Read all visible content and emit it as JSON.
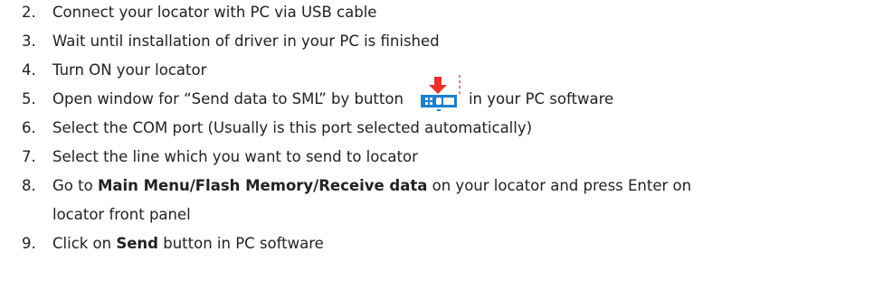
{
  "steps": [
    {
      "num": "2.",
      "text": "Connect your locator with PC via USB cable"
    },
    {
      "num": "3.",
      "text": "Wait until installation of driver in your PC is finished"
    },
    {
      "num": "4.",
      "text": "Turn ON your locator"
    },
    {
      "num": "5.",
      "text_before": "Open window for “Send data to SML” by button",
      "text_after": "in your PC software",
      "icon": "send-to-device-icon"
    },
    {
      "num": "6.",
      "text": "Select the COM port (Usually is this port selected automatically)"
    },
    {
      "num": "7.",
      "text": "Select the line which you want to send to locator"
    },
    {
      "num": "8.",
      "text_before": "Go to ",
      "bold": "Main Menu/Flash Memory/Receive data",
      "text_after": " on your locator and press Enter on",
      "text_line2": "locator front panel"
    },
    {
      "num": "9.",
      "text_before": "Click on ",
      "bold": "Send",
      "text_after": " button in PC software"
    }
  ],
  "colors": {
    "text": "#222222",
    "arrow": "#e8312a",
    "device_body": "#1a7fd0",
    "device_screen": "#ffffff",
    "dashed_line": "#c05080"
  }
}
